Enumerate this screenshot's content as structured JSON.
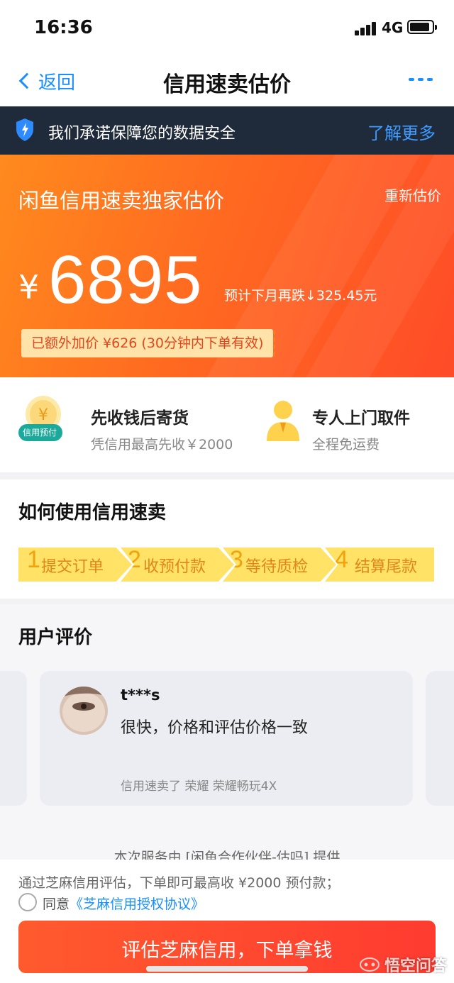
{
  "status_bar": {
    "time": "16:36",
    "network": "4G",
    "battery_level": 0.9
  },
  "nav": {
    "back_label": "返回",
    "title": "信用速卖估价",
    "more_icon": "more-icon",
    "accent_color": "#1890ff"
  },
  "security": {
    "text": "我们承诺保障您的数据安全",
    "link": "了解更多",
    "icon": "shield-icon"
  },
  "hero": {
    "title": "闲鱼信用速卖独家估价",
    "reestimate": "重新估价",
    "currency": "¥",
    "price": "6895",
    "forecast": "预计下月再跌↓325.45元",
    "bonus": "已额外加价 ¥626 (30分钟内下单有效)",
    "colors": [
      "#ff8a1e",
      "#ff4b28"
    ]
  },
  "benefits": [
    {
      "icon": "coin-icon",
      "badge": "信用预付",
      "title": "先收钱后寄货",
      "subtitle": "凭信用最高先收￥2000"
    },
    {
      "icon": "courier-icon",
      "title": "专人上门取件",
      "subtitle": "全程免运费"
    }
  ],
  "howto": {
    "title": "如何使用信用速卖",
    "steps": [
      {
        "num": "1",
        "label": "提交订单"
      },
      {
        "num": "2",
        "label": "收预付款"
      },
      {
        "num": "3",
        "label": "等待质检"
      },
      {
        "num": "4",
        "label": "结算尾款"
      }
    ]
  },
  "reviews": {
    "title": "用户评价",
    "items": [
      {
        "user": "t***s",
        "text": "很快，价格和评估价格一致",
        "meta": "信用速卖了 荣耀 荣耀畅玩4X"
      }
    ],
    "partner_note": "本次服务由 [闲鱼合作伙伴-估吗] 提供"
  },
  "footer": {
    "note": "通过芝麻信用评估，下单即可最高收 ¥2000 预付款；",
    "agree_prefix": "同意",
    "agreement": "《芝麻信用授权协议》",
    "cta": "评估芝麻信用，下单拿钱"
  },
  "watermark": {
    "text": "悟空问答"
  }
}
